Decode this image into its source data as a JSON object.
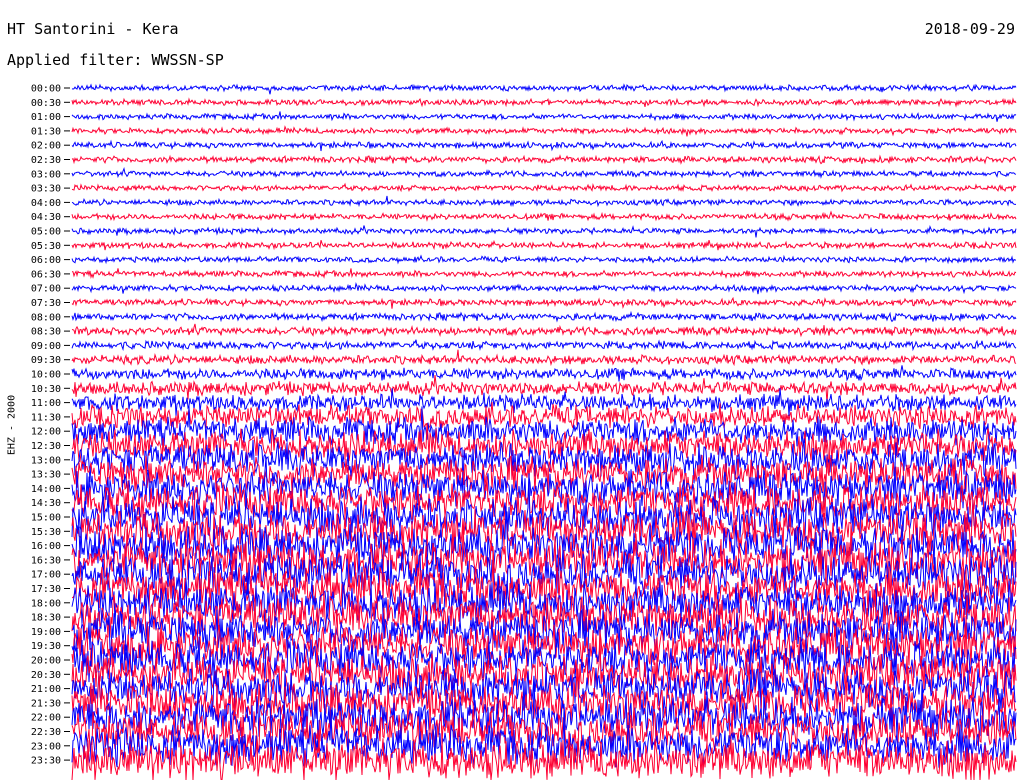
{
  "header": {
    "station": "HT Santorini - Kera",
    "date": "2018-09-29",
    "filter": "Applied filter: WWSSN-SP"
  },
  "chart_data": {
    "type": "line",
    "title": "HT Santorini - Kera",
    "ylabel": "EHZ - 2000",
    "row_labels": [
      "00:00",
      "00:30",
      "01:00",
      "01:30",
      "02:00",
      "02:30",
      "03:00",
      "03:30",
      "04:00",
      "04:30",
      "05:00",
      "05:30",
      "06:00",
      "06:30",
      "07:00",
      "07:30",
      "08:00",
      "08:30",
      "09:00",
      "09:30",
      "10:00",
      "10:30",
      "11:00",
      "11:30",
      "12:00",
      "12:30",
      "13:00",
      "13:30",
      "14:00",
      "14:30",
      "15:00",
      "15:30",
      "16:00",
      "16:30",
      "17:00",
      "17:30",
      "18:00",
      "18:30",
      "19:00",
      "19:30",
      "20:00",
      "20:30",
      "21:00",
      "21:30",
      "22:00",
      "22:30",
      "23:00",
      "23:30"
    ],
    "trace_colors": [
      "#0000ff",
      "#ff0033"
    ],
    "relative_amplitude": [
      0.7,
      0.7,
      0.7,
      0.7,
      0.75,
      0.8,
      0.7,
      0.7,
      0.7,
      0.75,
      0.7,
      0.75,
      0.7,
      0.75,
      0.75,
      0.8,
      0.9,
      1.0,
      1.0,
      1.1,
      1.4,
      1.7,
      2.1,
      2.8,
      3.4,
      3.8,
      4.0,
      4.2,
      4.4,
      4.6,
      4.8,
      5.0,
      5.0,
      5.0,
      5.0,
      5.0,
      5.0,
      5.0,
      5.0,
      5.0,
      4.9,
      4.9,
      4.9,
      4.9,
      4.9,
      4.9,
      4.9,
      4.9
    ]
  }
}
